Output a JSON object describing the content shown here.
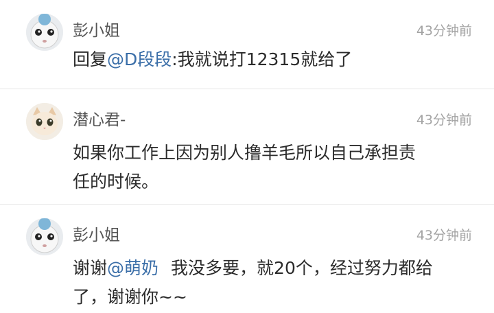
{
  "comments": [
    {
      "username": "彭小姐",
      "time": "43分钟前",
      "text_prefix": "回复",
      "mention": "@D段段",
      "text": ":我就说打12315就给了",
      "avatar_icon": "cartoon-doll-avatar"
    },
    {
      "username": "潜心君-",
      "time": "43分钟前",
      "line1": "如果你工作上因为别人撸羊毛所以自己承担责",
      "line2": "任的时候。",
      "avatar_icon": "cat-avatar"
    },
    {
      "username": "彭小姐",
      "time": "43分钟前",
      "text_prefix": "谢谢",
      "mention": "@萌奶",
      "line1_rest": "我没多要，就20个，经过努力都给",
      "line2": "了，谢谢你~~",
      "avatar_icon": "cartoon-doll-avatar"
    }
  ],
  "colors": {
    "mention": "#3a6ea8",
    "username": "#555555",
    "timestamp": "#a3a3a3",
    "divider": "#e6e6e6"
  }
}
